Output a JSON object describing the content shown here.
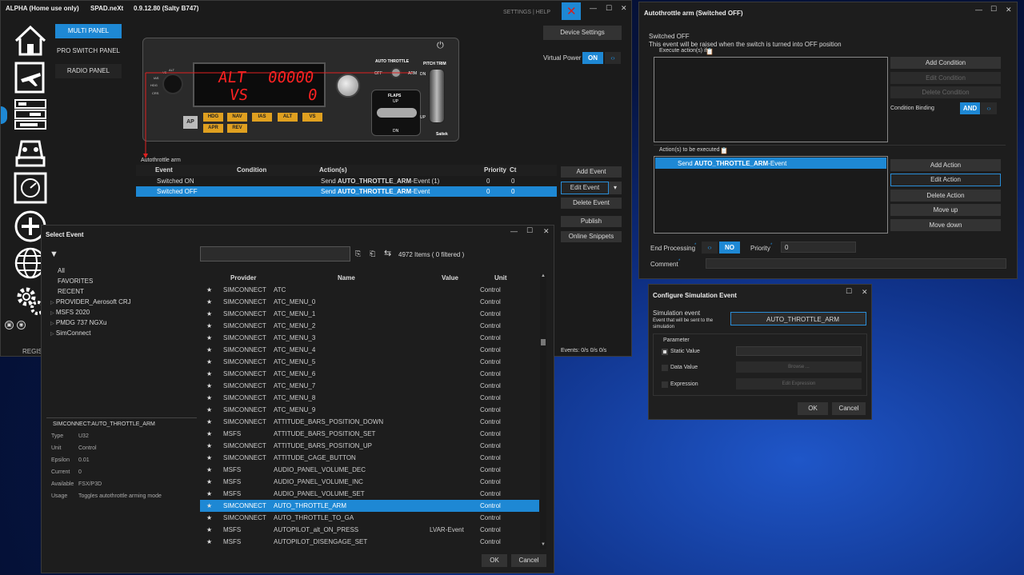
{
  "main_window": {
    "title": "ALPHA (Home use only)",
    "app_name": "SPAD.neXt",
    "version": "0.9.12.80 (Salty B747)",
    "settings_help": "SETTINGS | HELP",
    "panel_tabs": [
      "MULTI PANEL",
      "PRO SWITCH PANEL",
      "RADIO PANEL"
    ],
    "device_settings": "Device Settings",
    "virtual_power_label": "Virtual Power",
    "virtual_power_value": "ON",
    "register_label": "REGIST",
    "panel": {
      "display_left": "ALT",
      "display_right": "00000",
      "display_left2": "VS",
      "display_right2": "0",
      "buttons_row1": [
        "HDG",
        "NAV",
        "IAS",
        "ALT",
        "VS"
      ],
      "buttons_row2": [
        "APR",
        "REV"
      ],
      "ap_label": "AP",
      "auto_throttle_label": "AUTO THROTTLE",
      "off_label": "OFF",
      "arm_label": "ARM",
      "flaps_label": "FLAPS",
      "flaps_up": "UP",
      "flaps_dn": "DN",
      "pitch_trim_label": "PITCH TRIM",
      "trim_dn": "DN",
      "trim_up": "UP",
      "brand": "Saitek",
      "knob_labels": [
        "ALT",
        "VS",
        "IAS",
        "HDG",
        "CRS"
      ]
    },
    "section_label": "Autothrottle arm",
    "table_headers": [
      "Event",
      "Condition",
      "Action(s)",
      "Priority",
      "Ct"
    ],
    "rows": [
      {
        "event": "Switched ON",
        "condition": "",
        "action_prefix": "Send ",
        "action_bold": "AUTO_THROTTLE_ARM",
        "action_suffix": "-Event (1)",
        "priority": "0",
        "ct": "0"
      },
      {
        "event": "Switched OFF",
        "condition": "",
        "action_prefix": "Send ",
        "action_bold": "AUTO_THROTTLE_ARM",
        "action_suffix": "-Event",
        "priority": "0",
        "ct": "0"
      }
    ],
    "side_buttons": [
      "Add Event",
      "Edit Event",
      "Delete Event",
      "Publish",
      "Online Snippets"
    ],
    "events_status": "Events: 0/s 0/s 0/s"
  },
  "select_event": {
    "title": "Select Event",
    "search_placeholder": "",
    "items_count": "4972 Items ( 0 filtered )",
    "tree": [
      {
        "label": "All",
        "expandable": false
      },
      {
        "label": "FAVORITES",
        "expandable": false
      },
      {
        "label": "RECENT",
        "expandable": false
      },
      {
        "label": "PROVIDER_Aerosoft CRJ",
        "expandable": true
      },
      {
        "label": "MSFS 2020",
        "expandable": true
      },
      {
        "label": "PMDG 737 NGXu",
        "expandable": true
      },
      {
        "label": "SimConnect",
        "expandable": true
      }
    ],
    "detail_title": "SIMCONNECT:AUTO_THROTTLE_ARM",
    "details": [
      {
        "k": "Type",
        "v": "U32"
      },
      {
        "k": "Unit",
        "v": "Control"
      },
      {
        "k": "Epsilon",
        "v": "0.01"
      },
      {
        "k": "Current",
        "v": "0"
      },
      {
        "k": "Available",
        "v": "FSX/P3D"
      },
      {
        "k": "Usage",
        "v": "Toggles autothrottle arming mode"
      }
    ],
    "columns": [
      "Provider",
      "Name",
      "Value",
      "Unit"
    ],
    "rows": [
      {
        "provider": "SIMCONNECT",
        "name": "ATC",
        "value": "",
        "unit": "Control"
      },
      {
        "provider": "SIMCONNECT",
        "name": "ATC_MENU_0",
        "value": "",
        "unit": "Control"
      },
      {
        "provider": "SIMCONNECT",
        "name": "ATC_MENU_1",
        "value": "",
        "unit": "Control"
      },
      {
        "provider": "SIMCONNECT",
        "name": "ATC_MENU_2",
        "value": "",
        "unit": "Control"
      },
      {
        "provider": "SIMCONNECT",
        "name": "ATC_MENU_3",
        "value": "",
        "unit": "Control"
      },
      {
        "provider": "SIMCONNECT",
        "name": "ATC_MENU_4",
        "value": "",
        "unit": "Control"
      },
      {
        "provider": "SIMCONNECT",
        "name": "ATC_MENU_5",
        "value": "",
        "unit": "Control"
      },
      {
        "provider": "SIMCONNECT",
        "name": "ATC_MENU_6",
        "value": "",
        "unit": "Control"
      },
      {
        "provider": "SIMCONNECT",
        "name": "ATC_MENU_7",
        "value": "",
        "unit": "Control"
      },
      {
        "provider": "SIMCONNECT",
        "name": "ATC_MENU_8",
        "value": "",
        "unit": "Control"
      },
      {
        "provider": "SIMCONNECT",
        "name": "ATC_MENU_9",
        "value": "",
        "unit": "Control"
      },
      {
        "provider": "SIMCONNECT",
        "name": "ATTITUDE_BARS_POSITION_DOWN",
        "value": "",
        "unit": "Control"
      },
      {
        "provider": "MSFS",
        "name": "ATTITUDE_BARS_POSITION_SET",
        "value": "",
        "unit": "Control"
      },
      {
        "provider": "SIMCONNECT",
        "name": "ATTITUDE_BARS_POSITION_UP",
        "value": "",
        "unit": "Control"
      },
      {
        "provider": "SIMCONNECT",
        "name": "ATTITUDE_CAGE_BUTTON",
        "value": "",
        "unit": "Control"
      },
      {
        "provider": "MSFS",
        "name": "AUDIO_PANEL_VOLUME_DEC",
        "value": "",
        "unit": "Control"
      },
      {
        "provider": "MSFS",
        "name": "AUDIO_PANEL_VOLUME_INC",
        "value": "",
        "unit": "Control"
      },
      {
        "provider": "MSFS",
        "name": "AUDIO_PANEL_VOLUME_SET",
        "value": "",
        "unit": "Control"
      },
      {
        "provider": "SIMCONNECT",
        "name": "AUTO_THROTTLE_ARM",
        "value": "",
        "unit": "Control",
        "selected": true
      },
      {
        "provider": "SIMCONNECT",
        "name": "AUTO_THROTTLE_TO_GA",
        "value": "",
        "unit": "Control"
      },
      {
        "provider": "MSFS",
        "name": "AUTOPILOT_alt_ON_PRESS",
        "value": "LVAR-Event",
        "unit": "Control"
      },
      {
        "provider": "MSFS",
        "name": "AUTOPILOT_DISENGAGE_SET",
        "value": "",
        "unit": "Control"
      }
    ],
    "ok": "OK",
    "cancel": "Cancel"
  },
  "autothrottle_window": {
    "title": "Autothrottle arm (Switched OFF)",
    "line1": "Switched OFF",
    "line2": "This event will be raised when the switch is turned into OFF position",
    "execute_if": "Execute action(s) if",
    "add_condition": "Add Condition",
    "edit_condition": "Edit Condition",
    "delete_condition": "Delete Condition",
    "condition_binding": "Condition Binding",
    "binding_value": "AND",
    "actions_label": "Action(s) to be executed",
    "action_prefix": "Send ",
    "action_bold": "AUTO_THROTTLE_ARM",
    "action_suffix": "-Event",
    "add_action": "Add Action",
    "edit_action": "Edit Action",
    "delete_action": "Delete Action",
    "move_up": "Move up",
    "move_down": "Move down",
    "end_processing": "End Processing",
    "end_processing_value": "NO",
    "priority_label": "Priority",
    "priority_value": "0",
    "comment_label": "Comment"
  },
  "config_sim_event": {
    "title": "Configure Simulation Event",
    "sim_event_label": "Simulation event",
    "sim_event_desc": "Event that will be sent to the simulation",
    "sim_event_value": "AUTO_THROTTLE_ARM",
    "parameter_label": "Parameter",
    "static_value": "Static Value",
    "data_value": "Data Value",
    "expression": "Expression",
    "browse": "Browse ...",
    "edit_expression": "Edit Expression",
    "ok": "OK",
    "cancel": "Cancel"
  },
  "colors": {
    "accent": "#1e88d4",
    "display_red": "#ff2020",
    "panel_button": "#e0a020"
  }
}
